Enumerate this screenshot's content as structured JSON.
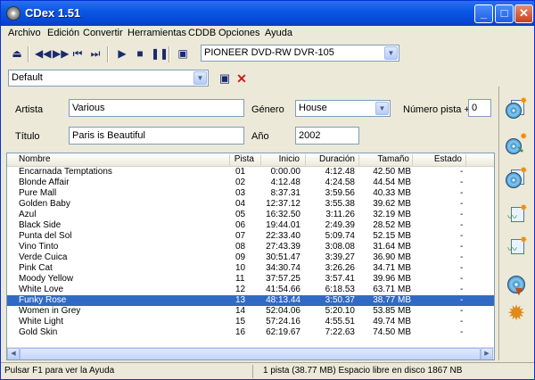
{
  "window": {
    "title": "CDex 1.51",
    "minimize_label": "_",
    "maximize_label": "□",
    "close_label": "✕"
  },
  "menu": [
    "Archivo",
    "Edición",
    "Convertir",
    "Herramientas",
    "CDDB",
    "Opciones",
    "Ayuda"
  ],
  "toolbar": {
    "drive": "PIONEER DVD-RW  DVR-105",
    "icons": [
      "eject-icon",
      "prev-track-icon",
      "rewind-icon",
      "skip-back-icon",
      "skip-forward-icon",
      "play-icon",
      "stop-icon",
      "pause-icon",
      "cddb-icon"
    ]
  },
  "profile": {
    "value": "Default"
  },
  "form": {
    "artista_label": "Artista",
    "artista": "Various",
    "genero_label": "Género",
    "genero": "House",
    "numpista_label": "Número pista +",
    "numpista": "0",
    "titulo_label": "Título",
    "titulo": "Paris is Beautiful",
    "anio_label": "Año",
    "anio": "2002"
  },
  "columns": {
    "nombre": "Nombre",
    "pista": "Pista",
    "inicio": "Inicio",
    "duracion": "Duración",
    "tamano": "Tamaño",
    "estado": "Estado"
  },
  "tracks": [
    {
      "name": "Encarnada Temptations",
      "pista": "01",
      "inicio": "0:00.00",
      "dur": "4:12.48",
      "size": "42.50 MB",
      "estado": "-"
    },
    {
      "name": "Blonde Affair",
      "pista": "02",
      "inicio": "4:12.48",
      "dur": "4:24.58",
      "size": "44.54 MB",
      "estado": "-"
    },
    {
      "name": "Pure Mall",
      "pista": "03",
      "inicio": "8:37.31",
      "dur": "3:59.56",
      "size": "40.33 MB",
      "estado": "-"
    },
    {
      "name": "Golden Baby",
      "pista": "04",
      "inicio": "12:37.12",
      "dur": "3:55.38",
      "size": "39.62 MB",
      "estado": "-"
    },
    {
      "name": "Azul",
      "pista": "05",
      "inicio": "16:32.50",
      "dur": "3:11.26",
      "size": "32.19 MB",
      "estado": "-"
    },
    {
      "name": "Black Side",
      "pista": "06",
      "inicio": "19:44.01",
      "dur": "2:49.39",
      "size": "28.52 MB",
      "estado": "-"
    },
    {
      "name": "Punta del Sol",
      "pista": "07",
      "inicio": "22:33.40",
      "dur": "5:09.74",
      "size": "52.15 MB",
      "estado": "-"
    },
    {
      "name": "Vino Tinto",
      "pista": "08",
      "inicio": "27:43.39",
      "dur": "3:08.08",
      "size": "31.64 MB",
      "estado": "-"
    },
    {
      "name": "Verde Cuica",
      "pista": "09",
      "inicio": "30:51.47",
      "dur": "3:39.27",
      "size": "36.90 MB",
      "estado": "-"
    },
    {
      "name": "Pink Cat",
      "pista": "10",
      "inicio": "34:30.74",
      "dur": "3:26.26",
      "size": "34.71 MB",
      "estado": "-"
    },
    {
      "name": "Moody Yellow",
      "pista": "11",
      "inicio": "37:57.25",
      "dur": "3:57.41",
      "size": "39.96 MB",
      "estado": "-"
    },
    {
      "name": "White Love",
      "pista": "12",
      "inicio": "41:54.66",
      "dur": "6:18.53",
      "size": "63.71 MB",
      "estado": "-"
    },
    {
      "name": "Funky Rose",
      "pista": "13",
      "inicio": "48:13.44",
      "dur": "3:50.37",
      "size": "38.77 MB",
      "estado": "-"
    },
    {
      "name": "Women in Grey",
      "pista": "14",
      "inicio": "52:04.06",
      "dur": "5:20.10",
      "size": "53.85 MB",
      "estado": "-"
    },
    {
      "name": "White Light",
      "pista": "15",
      "inicio": "57:24.16",
      "dur": "4:55.51",
      "size": "49.74 MB",
      "estado": "-"
    },
    {
      "name": "Gold Skin",
      "pista": "16",
      "inicio": "62:19.67",
      "dur": "7:22.63",
      "size": "74.50 MB",
      "estado": "-"
    }
  ],
  "selected_index": 12,
  "status": {
    "help": "Pulsar F1 para ver la Ayuda",
    "info": "1 pista (38.77 MB) Espacio libre en disco  1867 NB"
  },
  "sidebar_icons": [
    "extract-wav-icon",
    "extract-mp3-icon",
    "extract-partial-icon",
    "convert-wav-mp3-icon",
    "convert-mp3-wav-icon",
    "record-icon",
    "settings-icon"
  ],
  "colors": {
    "titlebar": "#0a58e3",
    "selection": "#316ac5",
    "face": "#ece9d8"
  }
}
